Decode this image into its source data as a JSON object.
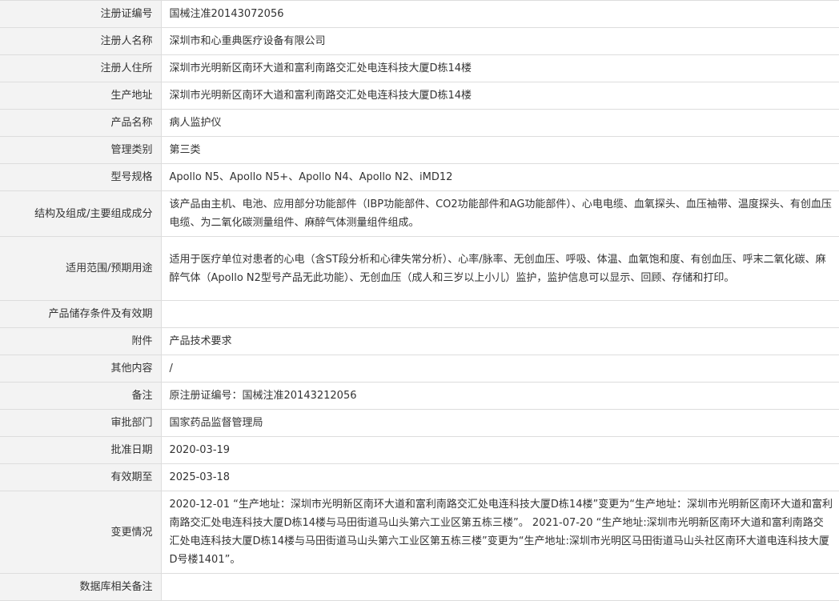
{
  "rows": [
    {
      "label": "注册证编号",
      "value": "国械注准20143072056"
    },
    {
      "label": "注册人名称",
      "value": "深圳市和心重典医疗设备有限公司"
    },
    {
      "label": "注册人住所",
      "value": "深圳市光明新区南环大道和富利南路交汇处电连科技大厦D栋14楼"
    },
    {
      "label": "生产地址",
      "value": "深圳市光明新区南环大道和富利南路交汇处电连科技大厦D栋14楼"
    },
    {
      "label": "产品名称",
      "value": "病人监护仪"
    },
    {
      "label": "管理类别",
      "value": "第三类"
    },
    {
      "label": "型号规格",
      "value": "Apollo N5、Apollo N5+、Apollo N4、Apollo N2、iMD12"
    },
    {
      "label": "结构及组成/主要组成成分",
      "value": "该产品由主机、电池、应用部分功能部件（IBP功能部件、CO2功能部件和AG功能部件）、心电电缆、血氧探头、血压袖带、温度探头、有创血压电缆、为二氧化碳测量组件、麻醉气体测量组件组成。"
    },
    {
      "label": "适用范围/预期用途",
      "value": "适用于医疗单位对患者的心电（含ST段分析和心律失常分析）、心率/脉率、无创血压、呼吸、体温、血氧饱和度、有创血压、呼末二氧化碳、麻醉气体（Apollo N2型号产品无此功能）、无创血压（成人和三岁以上小儿）监护，监护信息可以显示、回顾、存储和打印。"
    },
    {
      "label": "产品储存条件及有效期",
      "value": ""
    },
    {
      "label": "附件",
      "value": "产品技术要求"
    },
    {
      "label": "其他内容",
      "value": "/"
    },
    {
      "label": "备注",
      "value": "原注册证编号：国械注准20143212056"
    },
    {
      "label": "审批部门",
      "value": "国家药品监督管理局"
    },
    {
      "label": "批准日期",
      "value": "2020-03-19"
    },
    {
      "label": "有效期至",
      "value": "2025-03-18"
    },
    {
      "label": "变更情况",
      "value": "2020-12-01 “生产地址：深圳市光明新区南环大道和富利南路交汇处电连科技大厦D栋14楼”变更为“生产地址：深圳市光明新区南环大道和富利南路交汇处电连科技大厦D栋14楼与马田街道马山头第六工业区第五栋三楼”。 2021-07-20 “生产地址:深圳市光明新区南环大道和富利南路交汇处电连科技大厦D栋14楼与马田街道马山头第六工业区第五栋三楼”变更为“生产地址:深圳市光明区马田街道马山头社区南环大道电连科技大厦D号楼1401”。"
    },
    {
      "label": "数据库相关备注",
      "value": ""
    }
  ]
}
